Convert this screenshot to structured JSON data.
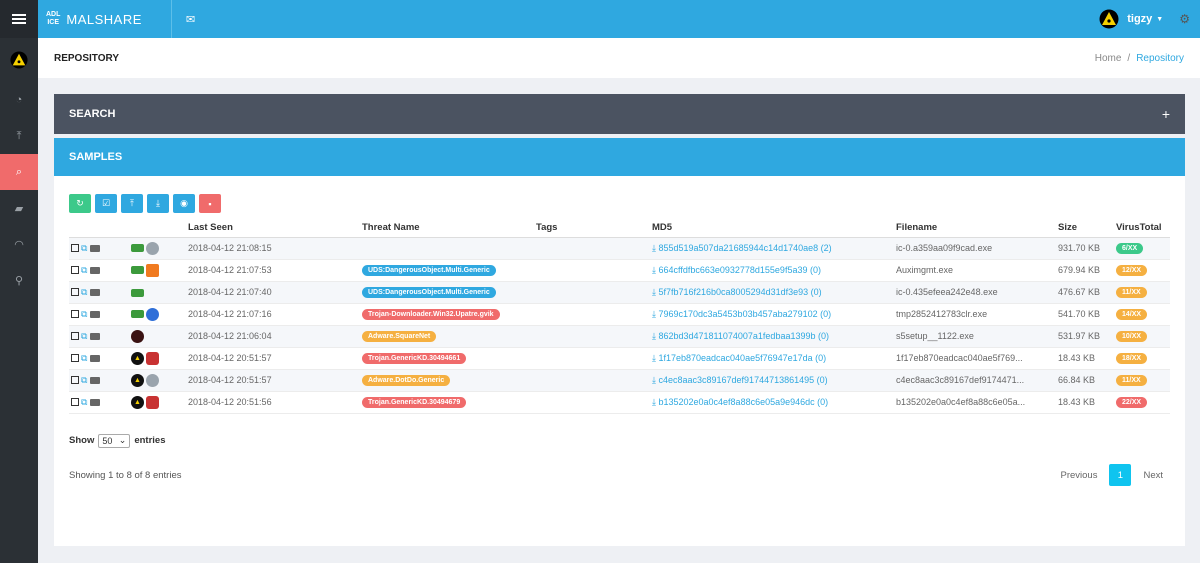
{
  "brand": {
    "logo_line1": "ADL",
    "logo_line2": "ICE",
    "name": "MALSHARE"
  },
  "topbar": {
    "mail_icon": "envelope-icon",
    "username": "tigzy",
    "settings_icon": "gear-icon"
  },
  "sidebar": {
    "items": [
      {
        "icon": "dashboard-icon",
        "glyph": "◔"
      },
      {
        "icon": "upload-icon",
        "glyph": "⤒"
      },
      {
        "icon": "search-icon",
        "glyph": "⌕",
        "active": true
      },
      {
        "icon": "comments-icon",
        "glyph": "▰"
      },
      {
        "icon": "rss-icon",
        "glyph": "◠"
      },
      {
        "icon": "rocket-icon",
        "glyph": "⚲"
      }
    ]
  },
  "page": {
    "title": "REPOSITORY",
    "breadcrumb_home": "Home",
    "breadcrumb_sep": "/",
    "breadcrumb_current": "Repository"
  },
  "search_panel": {
    "title": "SEARCH",
    "toggle": "+"
  },
  "samples_panel": {
    "title": "SAMPLES"
  },
  "toolbar": [
    {
      "name": "refresh-button",
      "glyph": "↻",
      "color": "green"
    },
    {
      "name": "select-all-button",
      "glyph": "☑",
      "color": "blue"
    },
    {
      "name": "upload-button",
      "glyph": "⤒",
      "color": "blue"
    },
    {
      "name": "download-button",
      "glyph": "⤓",
      "color": "blue"
    },
    {
      "name": "view-button",
      "glyph": "◉",
      "color": "blue"
    },
    {
      "name": "delete-button",
      "glyph": "▪",
      "color": "red"
    }
  ],
  "table": {
    "headers": [
      "",
      "",
      "Last Seen",
      "Threat Name",
      "Tags",
      "MD5",
      "Filename",
      "Size",
      "VirusTotal"
    ],
    "rows": [
      {
        "icons": [
          "green",
          "grey"
        ],
        "seen": "2018-04-12 21:08:15",
        "threat": "",
        "threat_color": "",
        "md5": "855d519a507da21685944c14d1740ae8 (2)",
        "file": "ic-0.a359aa09f9cad.exe",
        "size": "931.70 KB",
        "vt": "6/XX",
        "vt_color": "green"
      },
      {
        "icons": [
          "green",
          "orange"
        ],
        "seen": "2018-04-12 21:07:53",
        "threat": "UDS:DangerousObject.Multi.Generic",
        "threat_color": "blue",
        "md5": "664cffdfbc663e0932778d155e9f5a39 (0)",
        "file": "Auximgmt.exe",
        "size": "679.94 KB",
        "vt": "12/XX",
        "vt_color": "orange"
      },
      {
        "icons": [
          "green"
        ],
        "seen": "2018-04-12 21:07:40",
        "threat": "UDS:DangerousObject.Multi.Generic",
        "threat_color": "blue",
        "md5": "5f7fb716f216b0ca8005294d31df3e93 (0)",
        "file": "ic-0.435efeea242e48.exe",
        "size": "476.67 KB",
        "vt": "11/XX",
        "vt_color": "orange"
      },
      {
        "icons": [
          "green",
          "blue"
        ],
        "seen": "2018-04-12 21:07:16",
        "threat": "Trojan-Downloader.Win32.Upatre.gvik",
        "threat_color": "red",
        "md5": "7969c170dc3a5453b03b457aba279102 (0)",
        "file": "tmp2852412783clr.exe",
        "size": "541.70 KB",
        "vt": "14/XX",
        "vt_color": "orange"
      },
      {
        "icons": [
          "dark"
        ],
        "seen": "2018-04-12 21:06:04",
        "threat": "Adware.SquareNet",
        "threat_color": "orange",
        "md5": "862bd3d471811074007a1fedbaa1399b (0)",
        "file": "s5setup__1122.exe",
        "size": "531.97 KB",
        "vt": "10/XX",
        "vt_color": "orange"
      },
      {
        "icons": [
          "rad",
          "redcar"
        ],
        "seen": "2018-04-12 20:51:57",
        "threat": "Trojan.GenericKD.30494661",
        "threat_color": "red",
        "md5": "1f17eb870eadcac040ae5f76947e17da (0)",
        "file": "1f17eb870eadcac040ae5f769...",
        "size": "18.43 KB",
        "vt": "18/XX",
        "vt_color": "orange"
      },
      {
        "icons": [
          "rad",
          "grey"
        ],
        "seen": "2018-04-12 20:51:57",
        "threat": "Adware.DotDo.Generic",
        "threat_color": "orange",
        "md5": "c4ec8aac3c89167def91744713861495 (0)",
        "file": "c4ec8aac3c89167def9174471...",
        "size": "66.84 KB",
        "vt": "11/XX",
        "vt_color": "orange"
      },
      {
        "icons": [
          "rad",
          "redcar"
        ],
        "seen": "2018-04-12 20:51:56",
        "threat": "Trojan.GenericKD.30494679",
        "threat_color": "red",
        "md5": "b135202e0a0c4ef8a88c6e05a9e946dc (0)",
        "file": "b135202e0a0c4ef8a88c6e05a...",
        "size": "18.43 KB",
        "vt": "22/XX",
        "vt_color": "red"
      }
    ]
  },
  "length": {
    "show_label": "Show",
    "value": "50",
    "entries_label": "entries"
  },
  "info": "Showing 1 to 8 of 8 entries",
  "pagination": {
    "previous": "Previous",
    "current": "1",
    "next": "Next"
  }
}
